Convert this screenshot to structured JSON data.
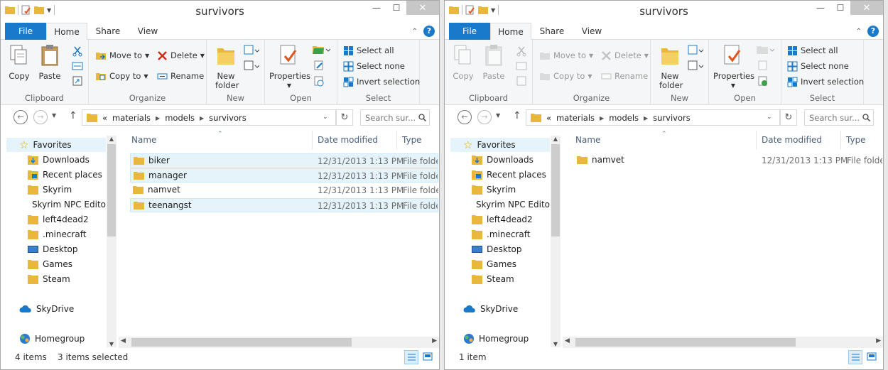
{
  "colors": {
    "accent": "#1979ca",
    "folder": "#e8b83c",
    "selection": "#e5f3fb"
  },
  "windows": [
    {
      "id": "left",
      "title": "survivors",
      "tabs": [
        "File",
        "Home",
        "Share",
        "View"
      ],
      "ribbon": {
        "clipboard": {
          "label": "Clipboard",
          "copy": "Copy",
          "paste": "Paste"
        },
        "organize": {
          "label": "Organize",
          "move_to": "Move to",
          "copy_to": "Copy to",
          "delete": "Delete",
          "rename": "Rename"
        },
        "new": {
          "label": "New",
          "new_folder": "New folder"
        },
        "open": {
          "label": "Open",
          "properties": "Properties"
        },
        "select": {
          "label": "Select",
          "select_all": "Select all",
          "select_none": "Select none",
          "invert": "Invert selection"
        }
      },
      "address": {
        "overflow": "«",
        "crumbs": [
          "materials",
          "models",
          "survivors"
        ]
      },
      "search": {
        "placeholder": "Search sur..."
      },
      "nav": {
        "favorites": "Favorites",
        "items": [
          "Downloads",
          "Recent places",
          "Skyrim",
          "Skyrim NPC Edito",
          "left4dead2",
          ".minecraft",
          "Desktop",
          "Games",
          "Steam"
        ],
        "skydrive": "SkyDrive",
        "homegroup": "Homegroup"
      },
      "columns": {
        "name": "Name",
        "date": "Date modified",
        "type": "Type"
      },
      "files": [
        {
          "name": "biker",
          "date": "12/31/2013 1:13 PM",
          "type": "File folder",
          "selected": true
        },
        {
          "name": "manager",
          "date": "12/31/2013 1:13 PM",
          "type": "File folder",
          "selected": true
        },
        {
          "name": "namvet",
          "date": "12/31/2013 1:13 PM",
          "type": "File folder",
          "selected": false
        },
        {
          "name": "teenangst",
          "date": "12/31/2013 1:13 PM",
          "type": "File folder",
          "selected": true
        }
      ],
      "status": {
        "count": "4 items",
        "selected": "3 items selected"
      }
    },
    {
      "id": "right",
      "title": "survivors",
      "tabs": [
        "File",
        "Home",
        "Share",
        "View"
      ],
      "ribbon": {
        "clipboard": {
          "label": "Clipboard",
          "copy": "Copy",
          "paste": "Paste"
        },
        "organize": {
          "label": "Organize",
          "move_to": "Move to",
          "copy_to": "Copy to",
          "delete": "Delete",
          "rename": "Rename"
        },
        "new": {
          "label": "New",
          "new_folder": "New folder"
        },
        "open": {
          "label": "Open",
          "properties": "Properties"
        },
        "select": {
          "label": "Select",
          "select_all": "Select all",
          "select_none": "Select none",
          "invert": "Invert selection"
        }
      },
      "address": {
        "overflow": "«",
        "crumbs": [
          "materials",
          "models",
          "survivors"
        ]
      },
      "search": {
        "placeholder": "Search sur..."
      },
      "nav": {
        "favorites": "Favorites",
        "items": [
          "Downloads",
          "Recent places",
          "Skyrim",
          "Skyrim NPC Edito",
          "left4dead2",
          ".minecraft",
          "Desktop",
          "Games",
          "Steam"
        ],
        "skydrive": "SkyDrive",
        "homegroup": "Homegroup"
      },
      "columns": {
        "name": "Name",
        "date": "Date modified",
        "type": "Type"
      },
      "files": [
        {
          "name": "namvet",
          "date": "12/31/2013 1:13 PM",
          "type": "File folder",
          "selected": false
        }
      ],
      "status": {
        "count": "1 item",
        "selected": ""
      }
    }
  ]
}
